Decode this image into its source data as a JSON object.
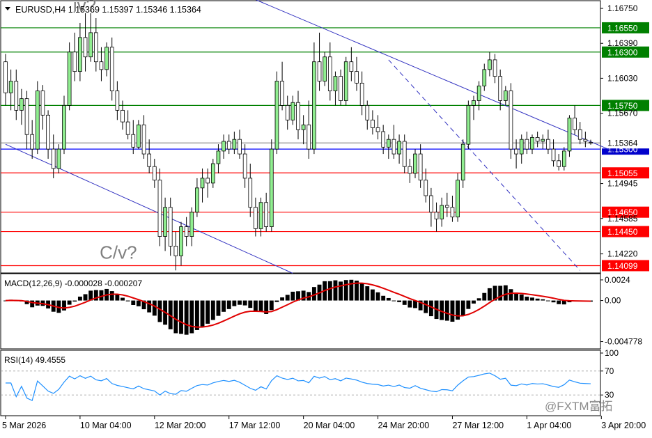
{
  "chart_data": {
    "type": "candlestick",
    "symbol_header": "EURUSD,H4  1.15369 1.15397 1.15346 1.15364",
    "price_axis": {
      "ylim": [
        1.14045,
        1.16815
      ],
      "tick_labels": [
        {
          "label": "1.16750",
          "value": 1.1675
        },
        {
          "label": "1.16390",
          "value": 1.1639
        },
        {
          "label": "1.16030",
          "value": 1.1603
        },
        {
          "label": "1.15670",
          "value": 1.1567
        },
        {
          "label": "1.14945",
          "value": 1.14945
        },
        {
          "label": "1.14585",
          "value": 1.14585
        },
        {
          "label": "1.14220",
          "value": 1.1422
        }
      ]
    },
    "horizontal_levels": [
      {
        "label": "1.16550",
        "value": 1.1655,
        "color": "#008000",
        "tag_bg": "#008000"
      },
      {
        "label": "1.16300",
        "value": 1.163,
        "color": "#008000",
        "tag_bg": "#008000"
      },
      {
        "label": "1.15750",
        "value": 1.1575,
        "color": "#008000",
        "tag_bg": "#008000"
      },
      {
        "label": "1.15300",
        "value": 1.153,
        "color": "#0000ff",
        "tag_bg": "#0000cc"
      },
      {
        "label": "1.15055",
        "value": 1.15055,
        "color": "#ff0000",
        "tag_bg": "#ff0000"
      },
      {
        "label": "1.14650",
        "value": 1.1465,
        "color": "#ff0000",
        "tag_bg": "#ff0000"
      },
      {
        "label": "1.14450",
        "value": 1.1445,
        "color": "#ff0000",
        "tag_bg": "#ff0000"
      },
      {
        "label": "1.14099",
        "value": 1.14099,
        "color": "#ff0000",
        "tag_bg": "#ff0000"
      }
    ],
    "current_price": {
      "label": "1.15364",
      "value": 1.15364
    },
    "annotations": [
      {
        "text": "iv?",
        "bar": 14,
        "price": 1.1672
      },
      {
        "text": "C/v?",
        "bar": 19,
        "price": 1.1417
      }
    ],
    "trendlines": [
      {
        "from_bar": 0,
        "from_price": 1.1535,
        "to_bar": 54,
        "to_price": 1.1402,
        "style": "solid",
        "color": "#3030c0"
      },
      {
        "from_bar": 47,
        "from_price": 1.1684,
        "to_bar": 115,
        "to_price": 1.1526,
        "style": "solid",
        "color": "#3030c0"
      },
      {
        "from_bar": 72,
        "from_price": 1.1622,
        "to_bar": 108,
        "to_price": 1.1405,
        "style": "dashed",
        "color": "#3030c0"
      }
    ],
    "candle_colors": {
      "up": "#90ee90",
      "down": "#ffffff",
      "outline": "#000000"
    },
    "candles_ohlc": [
      [
        1.162,
        1.1628,
        1.1575,
        1.1588
      ],
      [
        1.1588,
        1.1612,
        1.157,
        1.16
      ],
      [
        1.16,
        1.1612,
        1.156,
        1.157
      ],
      [
        1.157,
        1.1592,
        1.1555,
        1.1582
      ],
      [
        1.1582,
        1.159,
        1.153,
        1.1545
      ],
      [
        1.1545,
        1.156,
        1.152,
        1.153
      ],
      [
        1.153,
        1.16,
        1.1525,
        1.159
      ],
      [
        1.159,
        1.1596,
        1.155,
        1.1565
      ],
      [
        1.1565,
        1.157,
        1.152,
        1.153
      ],
      [
        1.153,
        1.1545,
        1.15,
        1.151
      ],
      [
        1.151,
        1.1535,
        1.1505,
        1.153
      ],
      [
        1.153,
        1.1585,
        1.1525,
        1.1575
      ],
      [
        1.1575,
        1.164,
        1.157,
        1.163
      ],
      [
        1.163,
        1.165,
        1.16,
        1.161
      ],
      [
        1.161,
        1.166,
        1.16,
        1.1645
      ],
      [
        1.1645,
        1.167,
        1.161,
        1.1625
      ],
      [
        1.1625,
        1.167,
        1.162,
        1.165
      ],
      [
        1.165,
        1.1665,
        1.161,
        1.162
      ],
      [
        1.162,
        1.1635,
        1.16,
        1.1612
      ],
      [
        1.1612,
        1.164,
        1.1605,
        1.1635
      ],
      [
        1.1635,
        1.1645,
        1.158,
        1.159
      ],
      [
        1.159,
        1.16,
        1.156,
        1.157
      ],
      [
        1.157,
        1.158,
        1.155,
        1.1558
      ],
      [
        1.1558,
        1.157,
        1.154,
        1.1545
      ],
      [
        1.1545,
        1.156,
        1.1525,
        1.1532
      ],
      [
        1.1532,
        1.156,
        1.153,
        1.1555
      ],
      [
        1.1555,
        1.1565,
        1.152,
        1.1525
      ],
      [
        1.1525,
        1.154,
        1.1505,
        1.1512
      ],
      [
        1.1512,
        1.152,
        1.149,
        1.1498
      ],
      [
        1.1498,
        1.151,
        1.143,
        1.144
      ],
      [
        1.144,
        1.148,
        1.1425,
        1.147
      ],
      [
        1.147,
        1.148,
        1.142,
        1.143
      ],
      [
        1.143,
        1.1445,
        1.1405,
        1.142
      ],
      [
        1.142,
        1.1455,
        1.141,
        1.145
      ],
      [
        1.145,
        1.146,
        1.143,
        1.144
      ],
      [
        1.144,
        1.147,
        1.143,
        1.1465
      ],
      [
        1.1465,
        1.15,
        1.146,
        1.149
      ],
      [
        1.149,
        1.151,
        1.1475,
        1.15
      ],
      [
        1.15,
        1.151,
        1.148,
        1.1495
      ],
      [
        1.1495,
        1.152,
        1.149,
        1.1515
      ],
      [
        1.1515,
        1.1535,
        1.1505,
        1.1528
      ],
      [
        1.1528,
        1.1545,
        1.152,
        1.1538
      ],
      [
        1.1538,
        1.1545,
        1.1525,
        1.153
      ],
      [
        1.153,
        1.1548,
        1.1525,
        1.154
      ],
      [
        1.154,
        1.155,
        1.152,
        1.1525
      ],
      [
        1.1525,
        1.1535,
        1.149,
        1.15
      ],
      [
        1.15,
        1.1515,
        1.146,
        1.147
      ],
      [
        1.147,
        1.148,
        1.144,
        1.1448
      ],
      [
        1.1448,
        1.148,
        1.144,
        1.1475
      ],
      [
        1.1475,
        1.1485,
        1.1445,
        1.145
      ],
      [
        1.145,
        1.154,
        1.1445,
        1.153
      ],
      [
        1.153,
        1.161,
        1.1525,
        1.16
      ],
      [
        1.16,
        1.162,
        1.157,
        1.1575
      ],
      [
        1.1575,
        1.1585,
        1.155,
        1.156
      ],
      [
        1.156,
        1.1585,
        1.1555,
        1.1578
      ],
      [
        1.1578,
        1.159,
        1.154,
        1.155
      ],
      [
        1.155,
        1.1565,
        1.1535,
        1.1555
      ],
      [
        1.1555,
        1.158,
        1.152,
        1.153
      ],
      [
        1.153,
        1.164,
        1.1525,
        1.162
      ],
      [
        1.162,
        1.165,
        1.159,
        1.16
      ],
      [
        1.16,
        1.163,
        1.1595,
        1.1625
      ],
      [
        1.1625,
        1.164,
        1.158,
        1.159
      ],
      [
        1.159,
        1.161,
        1.1575,
        1.1605
      ],
      [
        1.1605,
        1.1612,
        1.1575,
        1.158
      ],
      [
        1.158,
        1.1625,
        1.1575,
        1.162
      ],
      [
        1.162,
        1.1635,
        1.16,
        1.161
      ],
      [
        1.161,
        1.1625,
        1.159,
        1.1598
      ],
      [
        1.1598,
        1.161,
        1.1565,
        1.1575
      ],
      [
        1.1575,
        1.158,
        1.155,
        1.156
      ],
      [
        1.156,
        1.157,
        1.1545,
        1.1552
      ],
      [
        1.1552,
        1.1565,
        1.154,
        1.1548
      ],
      [
        1.1548,
        1.1555,
        1.1525,
        1.1532
      ],
      [
        1.1532,
        1.1545,
        1.152,
        1.154
      ],
      [
        1.154,
        1.1555,
        1.152,
        1.1525
      ],
      [
        1.1525,
        1.1545,
        1.1515,
        1.1538
      ],
      [
        1.1538,
        1.1545,
        1.1505,
        1.1512
      ],
      [
        1.1512,
        1.152,
        1.1495,
        1.1505
      ],
      [
        1.1505,
        1.153,
        1.15,
        1.1525
      ],
      [
        1.1525,
        1.1535,
        1.149,
        1.1498
      ],
      [
        1.1498,
        1.151,
        1.1475,
        1.1482
      ],
      [
        1.1482,
        1.149,
        1.145,
        1.1465
      ],
      [
        1.1465,
        1.1475,
        1.1445,
        1.1458
      ],
      [
        1.1458,
        1.148,
        1.145,
        1.1472
      ],
      [
        1.1472,
        1.1485,
        1.146,
        1.147
      ],
      [
        1.147,
        1.1482,
        1.1455,
        1.146
      ],
      [
        1.146,
        1.1505,
        1.1455,
        1.1498
      ],
      [
        1.1498,
        1.154,
        1.149,
        1.1535
      ],
      [
        1.1535,
        1.158,
        1.153,
        1.1575
      ],
      [
        1.1575,
        1.1585,
        1.156,
        1.158
      ],
      [
        1.158,
        1.16,
        1.157,
        1.1595
      ],
      [
        1.1595,
        1.1618,
        1.159,
        1.1612
      ],
      [
        1.1612,
        1.163,
        1.1605,
        1.1622
      ],
      [
        1.1622,
        1.1628,
        1.1598,
        1.1605
      ],
      [
        1.1605,
        1.1612,
        1.157,
        1.158
      ],
      [
        1.158,
        1.1595,
        1.1575,
        1.159
      ],
      [
        1.159,
        1.1598,
        1.152,
        1.153
      ],
      [
        1.153,
        1.154,
        1.151,
        1.1525
      ],
      [
        1.1525,
        1.1545,
        1.1515,
        1.154
      ],
      [
        1.154,
        1.1548,
        1.1525,
        1.153
      ],
      [
        1.153,
        1.1545,
        1.1525,
        1.1542
      ],
      [
        1.1542,
        1.1548,
        1.1532,
        1.1538
      ],
      [
        1.1538,
        1.1545,
        1.153,
        1.154
      ],
      [
        1.154,
        1.155,
        1.1525,
        1.153
      ],
      [
        1.153,
        1.154,
        1.1512,
        1.1518
      ],
      [
        1.1518,
        1.1525,
        1.1508,
        1.1512
      ],
      [
        1.1512,
        1.1532,
        1.1508,
        1.1528
      ],
      [
        1.1528,
        1.1565,
        1.1522,
        1.1562
      ],
      [
        1.1562,
        1.1575,
        1.1545,
        1.155
      ],
      [
        1.155,
        1.1558,
        1.1535,
        1.154
      ],
      [
        1.154,
        1.1548,
        1.1532,
        1.1538
      ],
      [
        1.15369,
        1.15397,
        1.15346,
        1.15364
      ]
    ],
    "macd": {
      "label": "MACD(12,26,9) -0.000028 -0.000207",
      "ylim": [
        -0.0053,
        0.0028
      ],
      "tick_labels": [
        {
          "label": "0.0024",
          "value": 0.0024
        },
        {
          "label": "0.00",
          "value": 0.0
        },
        {
          "label": "-0.004778",
          "value": -0.004778
        }
      ],
      "histogram_color": "#000000",
      "signal_color": "#e00000"
    },
    "rsi": {
      "label": "RSI(14) 49.4555",
      "ylim": [
        0,
        100
      ],
      "tick_labels": [
        {
          "label": "100",
          "value": 100
        },
        {
          "label": "70",
          "value": 70
        },
        {
          "label": "30",
          "value": 30
        }
      ],
      "levels": [
        70,
        30
      ],
      "line_color": "#1e90ff"
    },
    "time_axis": [
      {
        "label": "5 Mar 2026",
        "bar": 0
      },
      {
        "label": "10 Mar 04:00",
        "bar": 14
      },
      {
        "label": "12 Mar 20:00",
        "bar": 28
      },
      {
        "label": "17 Mar 12:00",
        "bar": 42
      },
      {
        "label": "20 Mar 04:00",
        "bar": 56
      },
      {
        "label": "24 Mar 20:00",
        "bar": 70
      },
      {
        "label": "27 Mar 12:00",
        "bar": 84
      },
      {
        "label": "1 Apr 04:00",
        "bar": 98
      },
      {
        "label": "3 Apr 20:00",
        "bar": 112
      }
    ],
    "watermark": "@FXTM富拓"
  }
}
